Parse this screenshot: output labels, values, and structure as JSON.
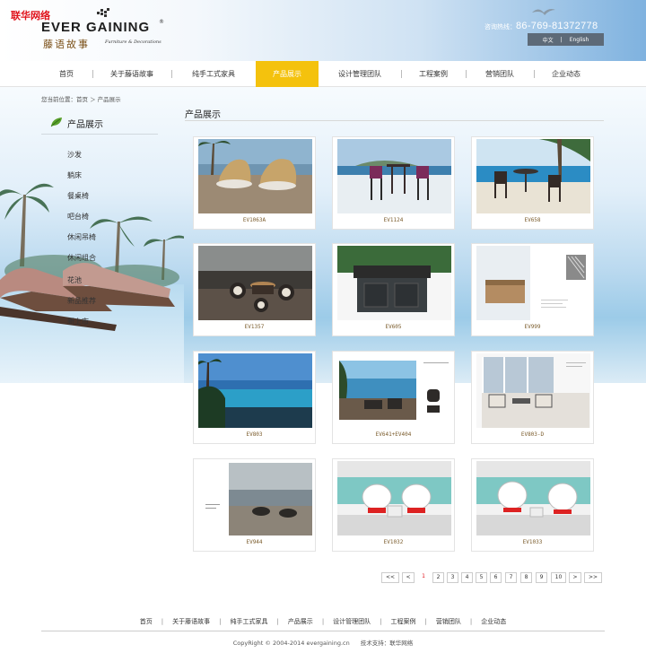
{
  "watermark": "联华网络",
  "brand": {
    "name_en": "EVER GAINING",
    "registered": "®",
    "name_cn": "藤语故事",
    "tagline": "Furniture & Decorations"
  },
  "contact": {
    "label": "咨询热线：",
    "phone": "86-769-81372778"
  },
  "languages": [
    "中文",
    "English"
  ],
  "nav": [
    {
      "label": "首页",
      "active": false
    },
    {
      "label": "关于藤语故事",
      "active": false
    },
    {
      "label": "纯手工式家具",
      "active": false
    },
    {
      "label": "产品展示",
      "active": true
    },
    {
      "label": "设计管理团队",
      "active": false
    },
    {
      "label": "工程案例",
      "active": false
    },
    {
      "label": "营销团队",
      "active": false
    },
    {
      "label": "企业动态",
      "active": false
    }
  ],
  "breadcrumb": "您当前位置：首页 ＞ 产品展示",
  "sidebar": {
    "title": "产品展示",
    "items": [
      "沙发",
      "躺床",
      "餐桌椅",
      "吧台椅",
      "休闲吊椅",
      "休闲组合",
      "花池",
      "新品推荐",
      "新上市"
    ]
  },
  "content": {
    "title": "产品展示",
    "products": [
      {
        "code": "EV1063A"
      },
      {
        "code": "EV1124"
      },
      {
        "code": "EV658"
      },
      {
        "code": "EV1357"
      },
      {
        "code": "EV605"
      },
      {
        "code": "EV999"
      },
      {
        "code": "EV803"
      },
      {
        "code": "EV641+EV404"
      },
      {
        "code": "EV803-D"
      },
      {
        "code": "EV944"
      },
      {
        "code": "EV1032"
      },
      {
        "code": "EV1033"
      }
    ]
  },
  "pager": {
    "first": "<<",
    "prev": "<",
    "pages": [
      "1",
      "2",
      "3",
      "4",
      "5",
      "6",
      "7",
      "8",
      "9",
      "10"
    ],
    "current": "1",
    "next": ">",
    "last": ">>"
  },
  "footer": {
    "links": [
      "首页",
      "关于藤语故事",
      "纯手工式家具",
      "产品展示",
      "设计管理团队",
      "工程案例",
      "营销团队",
      "企业动态"
    ],
    "copyright": "CopyRight © 2004-2014 evergaining.cn",
    "support": "技术支持：联华网络"
  },
  "colors": {
    "accent": "#f4c20d",
    "watermark": "#e0141c",
    "caption": "#7a5b2b"
  }
}
